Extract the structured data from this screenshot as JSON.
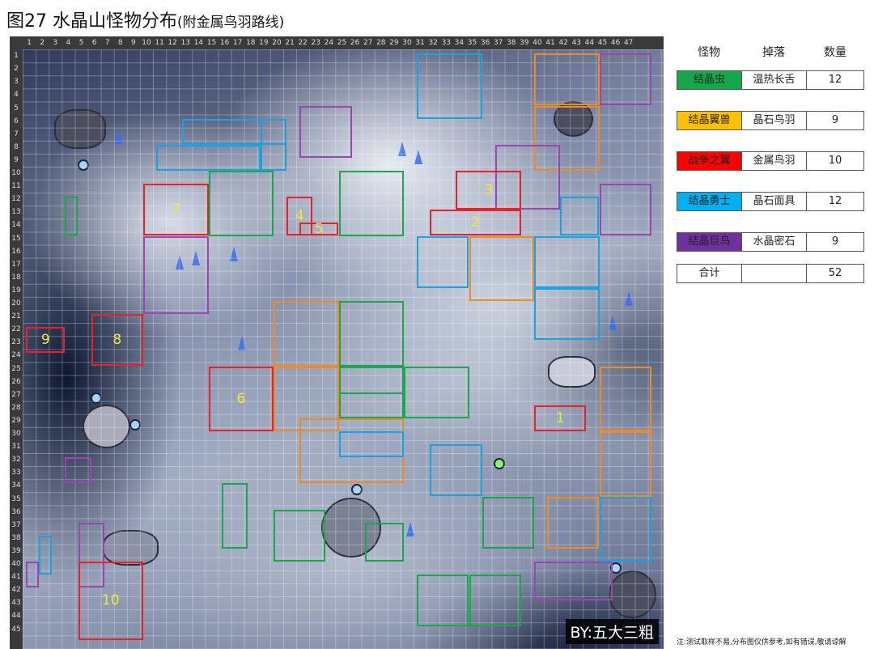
{
  "title": {
    "main": "图27 水晶山怪物分布",
    "sub": "(附金属鸟羽路线)"
  },
  "colors": {
    "green": "#1aa84a",
    "orange": "#f08a24",
    "red": "#e8222a",
    "blue": "#1ba3e0",
    "purple": "#9a48b0"
  },
  "map": {
    "columns": 48,
    "rows": 45,
    "byline": "BY:五大三粗",
    "zones": [
      {
        "type": "blue",
        "cells": [
          31,
          1,
          36,
          6
        ]
      },
      {
        "type": "orange",
        "cells": [
          40,
          1,
          45,
          5
        ]
      },
      {
        "type": "purple",
        "cells": [
          45,
          1,
          49,
          5
        ]
      },
      {
        "type": "orange",
        "cells": [
          40,
          5,
          45,
          10
        ]
      },
      {
        "type": "purple",
        "cells": [
          22,
          5,
          26,
          9
        ]
      },
      {
        "type": "blue",
        "cells": [
          13,
          6,
          21,
          8
        ]
      },
      {
        "type": "blue",
        "cells": [
          19,
          6,
          21,
          10
        ]
      },
      {
        "type": "blue",
        "cells": [
          11,
          8,
          19,
          10
        ]
      },
      {
        "type": "purple",
        "cells": [
          37,
          8,
          42,
          13
        ]
      },
      {
        "type": "green",
        "cells": [
          15,
          10,
          20,
          15
        ]
      },
      {
        "type": "green",
        "cells": [
          25,
          10,
          30,
          15
        ]
      },
      {
        "type": "red",
        "cells": [
          34,
          10,
          39,
          13
        ],
        "label": "3"
      },
      {
        "type": "red",
        "cells": [
          10,
          11,
          15,
          15
        ],
        "label": "7"
      },
      {
        "type": "green",
        "cells": [
          4,
          12,
          5,
          15
        ]
      },
      {
        "type": "red",
        "cells": [
          21,
          12,
          23,
          15
        ],
        "label": "4"
      },
      {
        "type": "red",
        "cells": [
          22,
          14,
          25,
          15
        ],
        "label": "5"
      },
      {
        "type": "red",
        "cells": [
          32,
          13,
          39,
          15
        ],
        "label": "2"
      },
      {
        "type": "purple",
        "cells": [
          45,
          11,
          49,
          15
        ]
      },
      {
        "type": "blue",
        "cells": [
          42,
          12,
          45,
          15
        ]
      },
      {
        "type": "blue",
        "cells": [
          31,
          15,
          35,
          19
        ]
      },
      {
        "type": "orange",
        "cells": [
          35,
          15,
          40,
          20
        ]
      },
      {
        "type": "blue",
        "cells": [
          40,
          15,
          45,
          19
        ]
      },
      {
        "type": "blue",
        "cells": [
          40,
          19,
          45,
          23
        ]
      },
      {
        "type": "purple",
        "cells": [
          10,
          15,
          15,
          21
        ]
      },
      {
        "type": "orange",
        "cells": [
          20,
          20,
          25,
          25
        ]
      },
      {
        "type": "green",
        "cells": [
          25,
          20,
          30,
          25
        ]
      },
      {
        "type": "red",
        "cells": [
          6,
          21,
          10,
          25
        ],
        "label": "8"
      },
      {
        "type": "red",
        "cells": [
          1,
          22,
          4,
          24
        ],
        "label": "9"
      },
      {
        "type": "red",
        "cells": [
          15,
          25,
          20,
          30
        ],
        "label": "6"
      },
      {
        "type": "orange",
        "cells": [
          20,
          25,
          25,
          30
        ]
      },
      {
        "type": "green",
        "cells": [
          25,
          25,
          30,
          29
        ]
      },
      {
        "type": "green",
        "cells": [
          25,
          27,
          30,
          29
        ]
      },
      {
        "type": "green",
        "cells": [
          30,
          25,
          35,
          29
        ]
      },
      {
        "type": "orange",
        "cells": [
          45,
          25,
          49,
          30
        ]
      },
      {
        "type": "red",
        "cells": [
          40,
          28,
          44,
          30
        ],
        "label": "1"
      },
      {
        "type": "orange",
        "cells": [
          22,
          29,
          30,
          34
        ]
      },
      {
        "type": "blue",
        "cells": [
          25,
          30,
          30,
          32
        ]
      },
      {
        "type": "blue",
        "cells": [
          32,
          31,
          36,
          35
        ]
      },
      {
        "type": "orange",
        "cells": [
          45,
          30,
          49,
          35
        ]
      },
      {
        "type": "purple",
        "cells": [
          4,
          32,
          6,
          34
        ]
      },
      {
        "type": "green",
        "cells": [
          16,
          34,
          18,
          39
        ]
      },
      {
        "type": "green",
        "cells": [
          20,
          36,
          24,
          40
        ]
      },
      {
        "type": "green",
        "cells": [
          27,
          37,
          30,
          40
        ]
      },
      {
        "type": "green",
        "cells": [
          36,
          35,
          40,
          39
        ]
      },
      {
        "type": "orange",
        "cells": [
          41,
          35,
          45,
          39
        ]
      },
      {
        "type": "blue",
        "cells": [
          45,
          35,
          49,
          40
        ]
      },
      {
        "type": "purple",
        "cells": [
          5,
          37,
          7,
          42
        ]
      },
      {
        "type": "blue",
        "cells": [
          2,
          38,
          3,
          41
        ]
      },
      {
        "type": "purple",
        "cells": [
          1,
          40,
          2,
          42
        ]
      },
      {
        "type": "red",
        "cells": [
          5,
          40,
          10,
          46
        ],
        "label": "10"
      },
      {
        "type": "purple",
        "cells": [
          40,
          40,
          46,
          43
        ]
      },
      {
        "type": "green",
        "cells": [
          31,
          41,
          35,
          45
        ]
      },
      {
        "type": "green",
        "cells": [
          35,
          41,
          39,
          45
        ]
      }
    ]
  },
  "legend": {
    "headers": [
      "怪物",
      "掉落",
      "数量"
    ],
    "rows": [
      {
        "monster": "结晶虫",
        "drop": "温热长舌",
        "count": "12",
        "color": "#14a84a"
      },
      {
        "monster": "结晶翼兽",
        "drop": "晶石鸟羽",
        "count": "9",
        "color": "#ffc000"
      },
      {
        "monster": "战争之翼",
        "drop": "金属鸟羽",
        "count": "10",
        "color": "#ff0000"
      },
      {
        "monster": "结晶勇士",
        "drop": "晶石面具",
        "count": "12",
        "color": "#00b0f0"
      },
      {
        "monster": "结晶巨鸟",
        "drop": "水晶密石",
        "count": "9",
        "color": "#7030a0"
      }
    ],
    "total": {
      "label": "合计",
      "drop": "",
      "count": "52"
    }
  },
  "note": "注:测试取样不易,分布图仅供参考,如有错误,敬请谅解"
}
